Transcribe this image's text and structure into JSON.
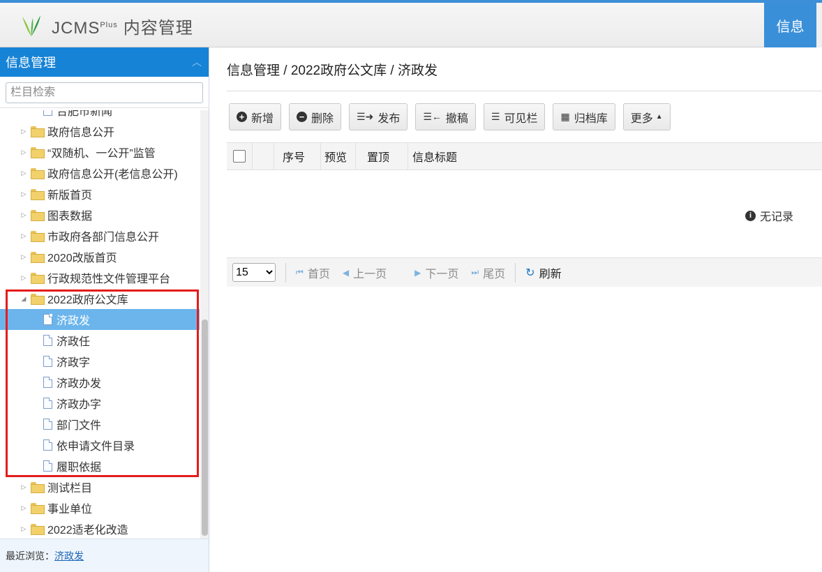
{
  "header": {
    "brand": "JCMS",
    "brand_sup": "Plus",
    "brand_title": "内容管理",
    "top_tab": "信息",
    "colors": {
      "accent": "#3a8fd9",
      "sidebar_header": "#1783d6",
      "selected": "#6bb5ec",
      "highlight_box": "#e51b1b"
    }
  },
  "sidebar": {
    "title": "信息管理",
    "search_placeholder": "栏目检索",
    "tree": [
      {
        "label": "合肥市新闻",
        "type": "doc",
        "level": 1
      },
      {
        "label": "政府信息公开",
        "type": "folder",
        "level": 0
      },
      {
        "label": "“双随机、一公开”监管",
        "type": "folder",
        "level": 0
      },
      {
        "label": "政府信息公开(老信息公开)",
        "type": "folder",
        "level": 0
      },
      {
        "label": "新版首页",
        "type": "folder",
        "level": 0
      },
      {
        "label": "图表数据",
        "type": "folder",
        "level": 0
      },
      {
        "label": "市政府各部门信息公开",
        "type": "folder",
        "level": 0
      },
      {
        "label": "2020改版首页",
        "type": "folder",
        "level": 0
      },
      {
        "label": "行政规范性文件管理平台",
        "type": "folder",
        "level": 0
      },
      {
        "label": "2022政府公文库",
        "type": "folder-open",
        "level": 0
      },
      {
        "label": "济政发",
        "type": "doc",
        "level": 1,
        "selected": true
      },
      {
        "label": "济政任",
        "type": "doc",
        "level": 1
      },
      {
        "label": "济政字",
        "type": "doc",
        "level": 1
      },
      {
        "label": "济政办发",
        "type": "doc",
        "level": 1
      },
      {
        "label": "济政办字",
        "type": "doc",
        "level": 1
      },
      {
        "label": "部门文件",
        "type": "doc",
        "level": 1
      },
      {
        "label": "依申请文件目录",
        "type": "doc",
        "level": 1
      },
      {
        "label": "履职依据",
        "type": "doc",
        "level": 1
      },
      {
        "label": "测试栏目",
        "type": "folder",
        "level": 0
      },
      {
        "label": "事业单位",
        "type": "folder",
        "level": 0
      },
      {
        "label": "2022适老化改造",
        "type": "folder",
        "level": 0
      }
    ],
    "recent_label": "最近浏览：",
    "recent_link": "济政发"
  },
  "main": {
    "breadcrumb": "信息管理 / 2022政府公文库 / 济政发",
    "toolbar": {
      "add": "新增",
      "delete": "删除",
      "publish": "发布",
      "withdraw": "撤稿",
      "columns": "可见栏",
      "archive": "归档库",
      "more": "更多"
    },
    "table": {
      "col_index": "序号",
      "col_preview": "预览",
      "col_top": "置顶",
      "col_title": "信息标题",
      "empty": "无记录"
    },
    "pager": {
      "page_size": "15",
      "first": "首页",
      "prev": "上一页",
      "next": "下一页",
      "last": "尾页",
      "refresh": "刷新"
    }
  }
}
